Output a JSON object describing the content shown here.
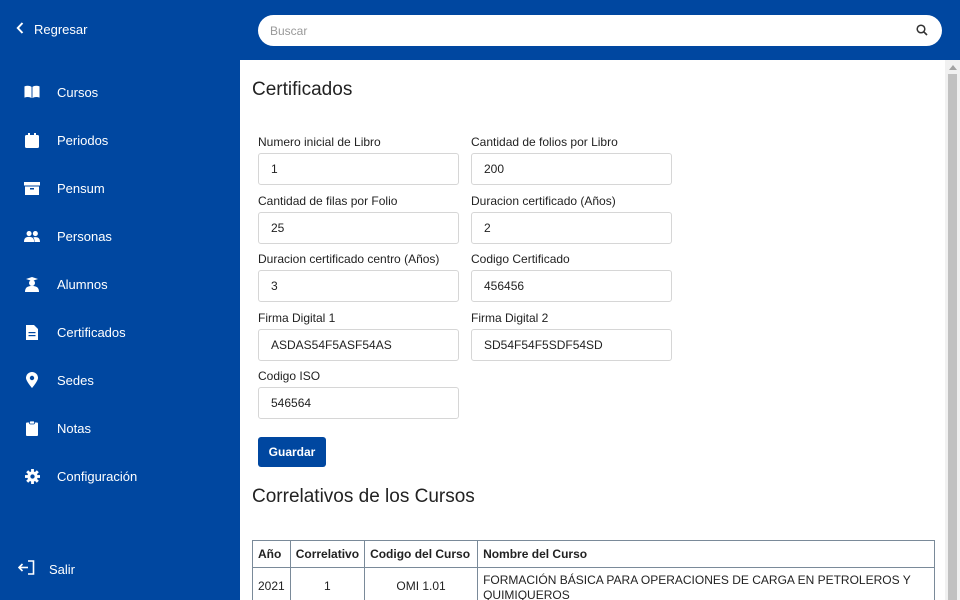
{
  "sidebar": {
    "back_label": "Regresar",
    "items": [
      {
        "label": "Cursos",
        "icon": "book-icon"
      },
      {
        "label": "Periodos",
        "icon": "calendar-icon"
      },
      {
        "label": "Pensum",
        "icon": "archive-icon"
      },
      {
        "label": "Personas",
        "icon": "people-icon"
      },
      {
        "label": "Alumnos",
        "icon": "graduate-icon"
      },
      {
        "label": "Certificados",
        "icon": "document-icon"
      },
      {
        "label": "Sedes",
        "icon": "map-pin-icon"
      },
      {
        "label": "Notas",
        "icon": "clipboard-icon"
      },
      {
        "label": "Configuración",
        "icon": "gear-icon"
      }
    ],
    "logout_label": "Salir"
  },
  "search": {
    "placeholder": "Buscar",
    "value": ""
  },
  "page": {
    "title": "Certificados",
    "fields": [
      {
        "label": "Numero inicial de Libro",
        "value": "1"
      },
      {
        "label": "Cantidad de folios por Libro",
        "value": "200"
      },
      {
        "label": "Cantidad de filas por Folio",
        "value": "25"
      },
      {
        "label": "Duracion certificado (Años)",
        "value": "2"
      },
      {
        "label": "Duracion certificado centro (Años)",
        "value": "3"
      },
      {
        "label": "Codigo Certificado",
        "value": "456456"
      },
      {
        "label": "Firma Digital 1",
        "value": "ASDAS54F5ASF54AS"
      },
      {
        "label": "Firma Digital 2",
        "value": "SD54F54F5SDF54SD"
      },
      {
        "label": "Codigo ISO",
        "value": "546564"
      }
    ],
    "save_label": "Guardar",
    "section_title": "Correlativos de los Cursos",
    "table": {
      "headers": [
        "Año",
        "Correlativo",
        "Codigo del Curso",
        "Nombre del Curso"
      ],
      "rows": [
        [
          "2021",
          "1",
          "OMI 1.01",
          "FORMACIÓN BÁSICA PARA OPERACIONES DE CARGA EN PETROLEROS Y QUIMIQUEROS"
        ]
      ]
    }
  },
  "colors": {
    "brand": "#0047a0",
    "border": "#d6d6d6"
  }
}
